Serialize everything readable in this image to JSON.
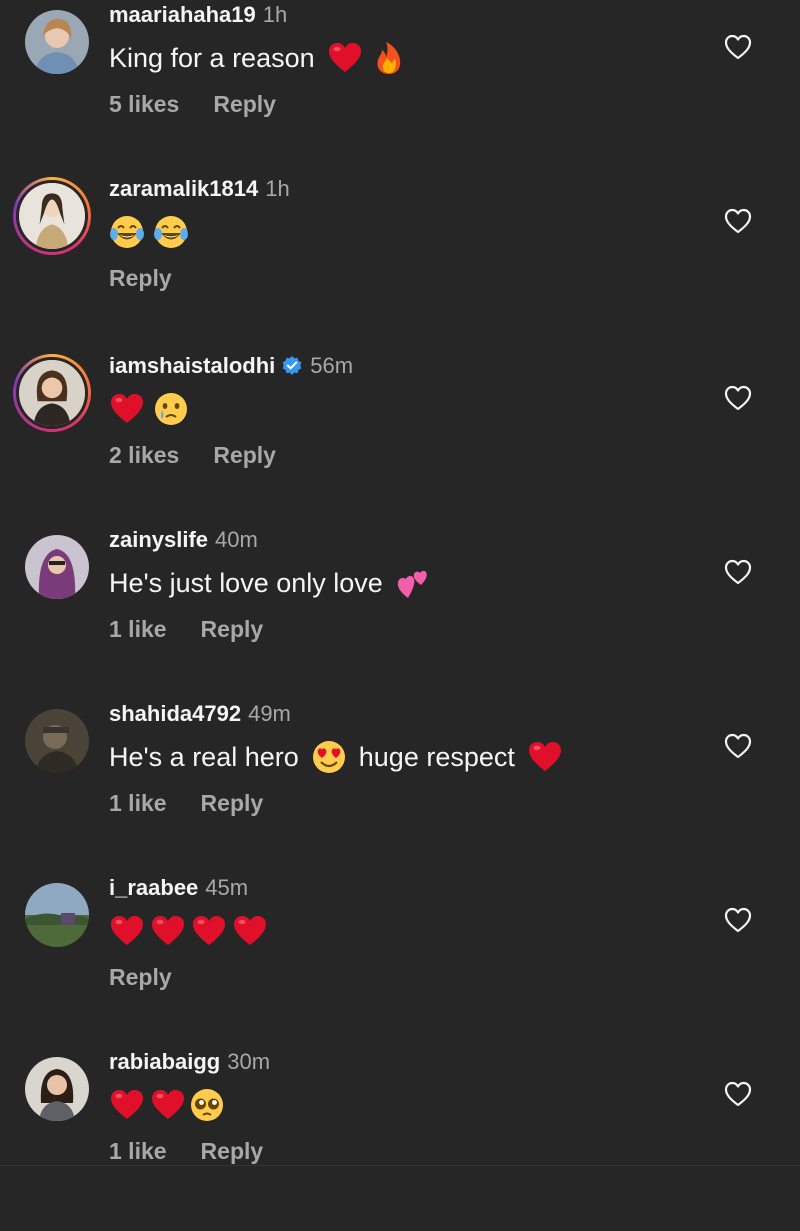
{
  "colors": {
    "background": "#262626",
    "username": "#f5f5f5",
    "muted": "#a8a8a8",
    "verified": "#3797f0",
    "heart_emoji": "#e0102b"
  },
  "actions": {
    "reply_label": "Reply",
    "like_icon": "heart-outline-icon"
  },
  "comments": [
    {
      "username": "maariahaha19",
      "time": "1h",
      "text": "King for a reason",
      "emojis": [
        "red-heart",
        "fire"
      ],
      "likes": "5 likes",
      "verified": false,
      "story_ring": false
    },
    {
      "username": "zaramalik1814",
      "time": "1h",
      "text": "",
      "emojis": [
        "tears-of-joy",
        "tears-of-joy"
      ],
      "likes": "",
      "verified": false,
      "story_ring": true
    },
    {
      "username": "iamshaistalodhi",
      "time": "56m",
      "text": "",
      "emojis": [
        "red-heart",
        "face-holding-back-tears"
      ],
      "likes": "2 likes",
      "verified": true,
      "story_ring": true
    },
    {
      "username": "zainyslife",
      "time": "40m",
      "text": "He's just love only love",
      "emojis": [
        "two-hearts"
      ],
      "likes": "1 like",
      "verified": false,
      "story_ring": false
    },
    {
      "username": "shahida4792",
      "time": "49m",
      "text_before": "He's a real hero",
      "text_after": "huge respect",
      "emojis": [
        "heart-eyes",
        "red-heart"
      ],
      "likes": "1 like",
      "verified": false,
      "story_ring": false
    },
    {
      "username": "i_raabee",
      "time": "45m",
      "text": "",
      "emojis": [
        "red-heart",
        "red-heart",
        "red-heart",
        "red-heart"
      ],
      "likes": "",
      "verified": false,
      "story_ring": false
    },
    {
      "username": "rabiabaigg",
      "time": "30m",
      "text": "",
      "emojis": [
        "red-heart",
        "red-heart",
        "pleading-face"
      ],
      "likes": "1 like",
      "verified": false,
      "story_ring": false
    }
  ]
}
